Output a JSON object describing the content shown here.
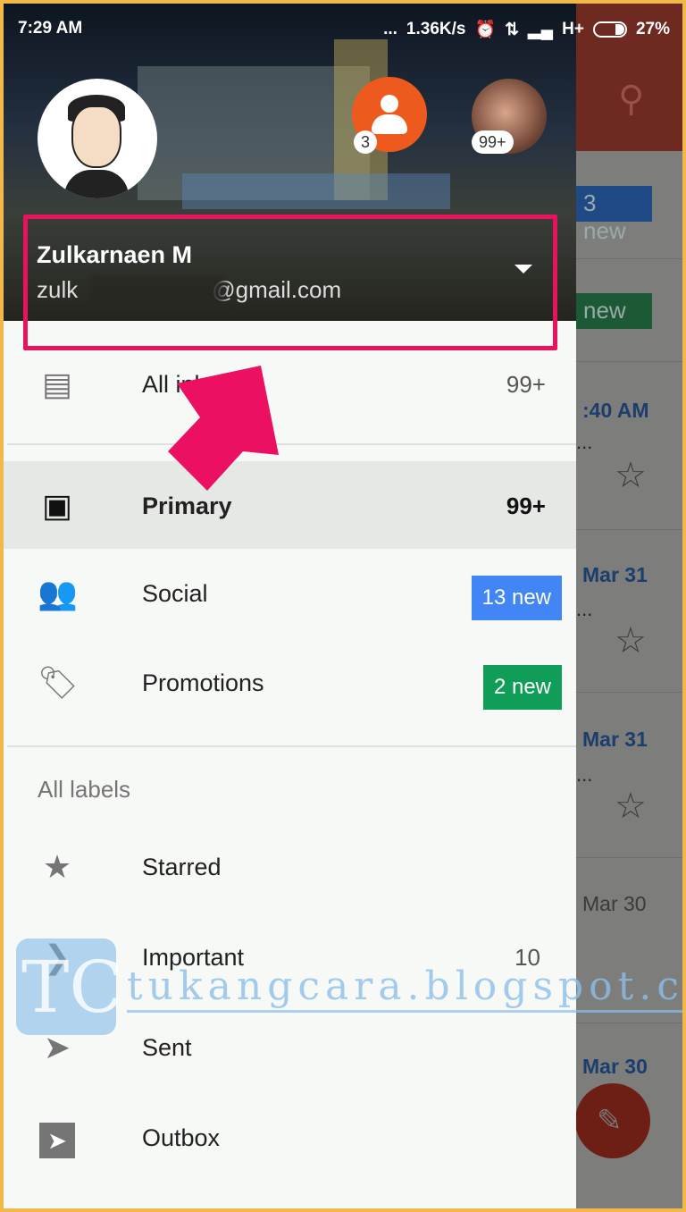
{
  "status_bar": {
    "time": "7:29 AM",
    "dots": "...",
    "speed": "1.36K/s",
    "network": "H+",
    "battery": "27%"
  },
  "account": {
    "name": "Zulkarnaen M",
    "email_prefix": "zulk",
    "email_domain": "@gmail.com",
    "other_accounts": [
      {
        "count": "3",
        "color": "#ee5a1e"
      },
      {
        "count": "99+"
      }
    ]
  },
  "menu": {
    "all_inboxes": {
      "label": "All inboxes",
      "count": "99+"
    },
    "primary": {
      "label": "Primary",
      "count": "99+"
    },
    "social": {
      "label": "Social",
      "badge": "13 new",
      "color": "#4285f4"
    },
    "promotions": {
      "label": "Promotions",
      "badge": "2 new",
      "color": "#0f9d58"
    },
    "labels_header": "All labels",
    "starred": {
      "label": "Starred"
    },
    "important": {
      "label": "Important",
      "count": "10"
    },
    "sent": {
      "label": "Sent"
    },
    "outbox": {
      "label": "Outbox"
    }
  },
  "background_list": {
    "badges": [
      "3 new",
      "new"
    ],
    "dates": [
      ":40 AM",
      "Mar 31",
      "Mar 31",
      "Mar 30",
      "Mar 30"
    ]
  },
  "watermark": {
    "logo": "TC",
    "text": "tukangcara.blogspot.com"
  },
  "highlight_color": "#e8135c"
}
